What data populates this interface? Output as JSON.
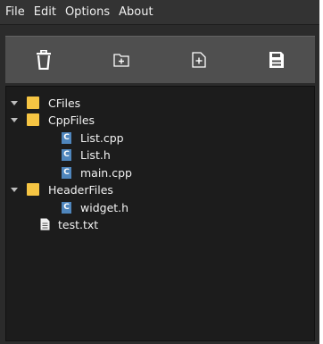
{
  "menu": {
    "items": [
      "File",
      "Edit",
      "Options",
      "About"
    ]
  },
  "toolbar": {
    "buttons": [
      {
        "name": "delete",
        "icon": "trash-icon"
      },
      {
        "name": "new-folder",
        "icon": "folder-plus-icon"
      },
      {
        "name": "new-file",
        "icon": "file-plus-icon"
      },
      {
        "name": "save",
        "icon": "save-icon"
      }
    ]
  },
  "tree": {
    "items": [
      {
        "label": "CFiles",
        "type": "folder"
      },
      {
        "label": "CppFiles",
        "type": "folder"
      },
      {
        "label": "List.cpp",
        "type": "c-file"
      },
      {
        "label": "List.h",
        "type": "c-file"
      },
      {
        "label": "main.cpp",
        "type": "c-file"
      },
      {
        "label": "HeaderFiles",
        "type": "folder"
      },
      {
        "label": "widget.h",
        "type": "c-file"
      },
      {
        "label": "test.txt",
        "type": "text-file"
      }
    ],
    "file_badge": "C"
  },
  "colors": {
    "window_bg": "#2b2b2b",
    "toolbar_bg": "#4f4f4f",
    "tree_bg": "#1c1c1c",
    "folder": "#f6c543",
    "c_file": "#4f86bd",
    "text": "#f2f2f2"
  }
}
